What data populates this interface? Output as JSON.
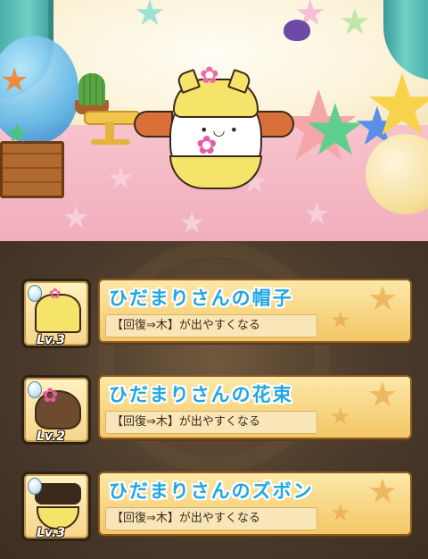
{
  "items": [
    {
      "title": "ひだまりさんの帽子",
      "description": "【回復⇒木】が出やすくなる",
      "level": "Lv.3",
      "icon": "hat-icon"
    },
    {
      "title": "ひだまりさんの花束",
      "description": "【回復⇒木】が出やすくなる",
      "level": "Lv.2",
      "icon": "bouquet-icon"
    },
    {
      "title": "ひだまりさんのズボン",
      "description": "【回復⇒木】が出やすくなる",
      "level": "Lv.3",
      "icon": "pants-icon"
    }
  ],
  "colors": {
    "title_text": "#1fa6e3",
    "card_fill": "#f3c766",
    "panel_bg": "#4b3a2a"
  }
}
